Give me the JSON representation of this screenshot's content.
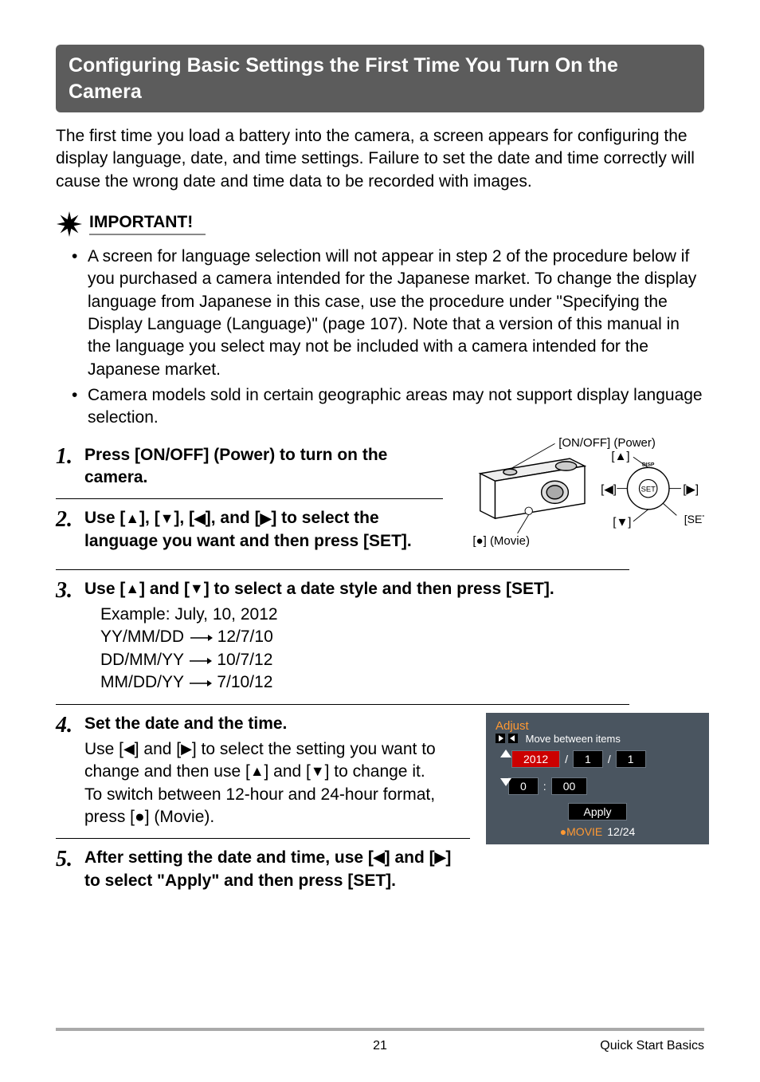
{
  "header": {
    "title": "Configuring Basic Settings the First Time You Turn On the Camera"
  },
  "intro": "The first time you load a battery into the camera, a screen appears for configuring the display language, date, and time settings. Failure to set the date and time correctly will cause the wrong date and time data to be recorded with images.",
  "important": {
    "label": "IMPORTANT!",
    "items": [
      "A screen for language selection will not appear in step 2 of the procedure below if you purchased a camera intended for the Japanese market. To change the display language from Japanese in this case, use the procedure under \"Specifying the Display Language (Language)\" (page 107). Note that a version of this manual in the language you select may not be included with a camera intended for the Japanese market.",
      "Camera models sold in certain geographic areas may not support display language selection."
    ]
  },
  "steps": {
    "s1": {
      "num": "1.",
      "title": "Press [ON/OFF] (Power) to turn on the camera."
    },
    "s2": {
      "num": "2.",
      "title_parts": {
        "p1": "Use [",
        "p2": "], [",
        "p3": "], [",
        "p4": "], and [",
        "p5": "] to select the language you want and then press [SET]."
      }
    },
    "s3": {
      "num": "3.",
      "title_parts": {
        "p1": "Use [",
        "p2": "] and [",
        "p3": "] to select a date style and then press [SET]."
      },
      "sub": {
        "l1": "Example: July, 10, 2012",
        "l2a": "YY/MM/DD",
        "l2b": "12/7/10",
        "l3a": "DD/MM/YY",
        "l3b": "10/7/12",
        "l4a": "MM/DD/YY",
        "l4b": "7/10/12"
      }
    },
    "s4": {
      "num": "4.",
      "title": "Set the date and the time.",
      "sub_parts": {
        "p1": "Use [",
        "p2": "] and [",
        "p3": "] to select the setting you want to change and then use [",
        "p4": "] and [",
        "p5": "] to change it.",
        "p6": "To switch between 12-hour and 24-hour format, press [",
        "p7": "] (Movie)."
      }
    },
    "s5": {
      "num": "5.",
      "title_parts": {
        "p1": "After setting the date and time, use [",
        "p2": "] and [",
        "p3": "] to select \"Apply\" and then press [SET]."
      }
    }
  },
  "diagram": {
    "onoff": "[ON/OFF] (Power)",
    "up": "[▲]",
    "down": "[▼]",
    "left": "[◀]",
    "right": "[▶]",
    "set": "[SET]",
    "movie": "] (Movie)",
    "disp": "DISP"
  },
  "screenshot": {
    "title": "Adjust",
    "hint": "Move between items",
    "year": "2012",
    "month": "1",
    "day": "1",
    "hour": "0",
    "minute": "00",
    "apply": "Apply",
    "movie": "●MOVIE",
    "fmt": "12/24"
  },
  "footer": {
    "page": "21",
    "section": "Quick Start Basics"
  },
  "glyphs": {
    "up": "▲",
    "down": "▼",
    "left": "◀",
    "right": "▶",
    "dot": "●",
    "bracket_open": "[",
    "bracket_close": "]"
  }
}
